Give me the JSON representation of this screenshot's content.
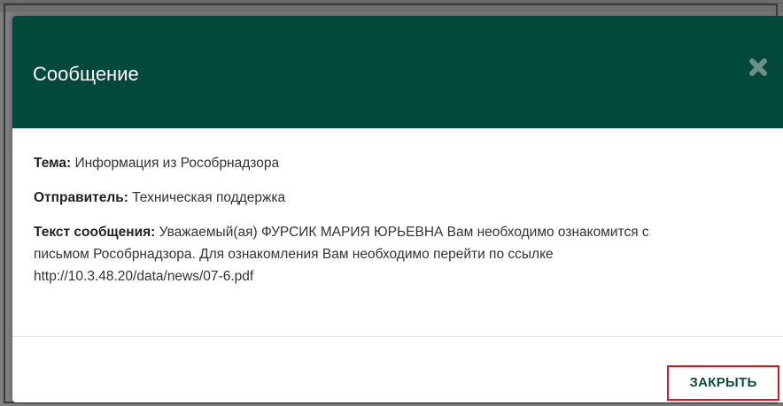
{
  "modal": {
    "title": "Сообщение",
    "close_icon": "close-icon",
    "fields": {
      "subject_label": "Тема:",
      "subject_value": " Информация из Рособрнадзора",
      "sender_label": "Отправитель:",
      "sender_value": " Техническая поддержка",
      "text_label": "Текст сообщения:",
      "text_value_line1": " Уважаемый(ая) ФУРСИК МАРИЯ ЮРЬЕВНА Вам необходимо ознакомится с",
      "text_value_line2": "письмом Рособрнадзора. Для ознакомления Вам необходимо перейти по ссылке",
      "text_value_line3": "http://10.3.48.20/data/news/07-6.pdf"
    },
    "footer": {
      "close_button_label": "ЗАКРЫТЬ"
    }
  },
  "colors": {
    "header_bg": "#02493c",
    "button_text": "#0b4e3b",
    "highlight_border": "#e0141b"
  }
}
